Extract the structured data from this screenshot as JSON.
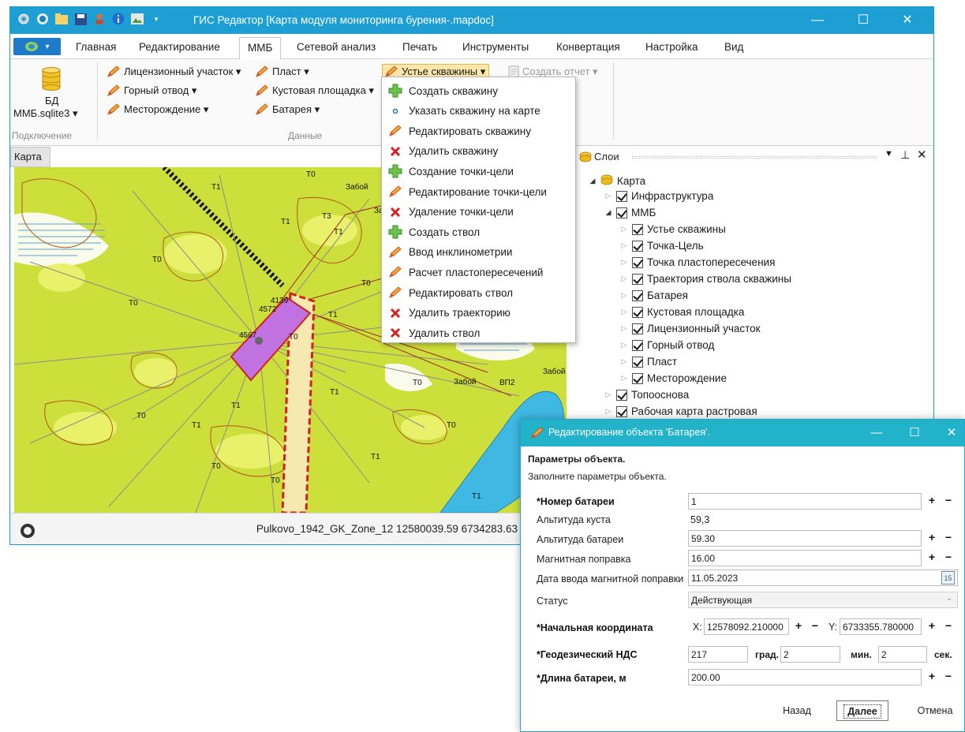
{
  "window": {
    "title": "ГИС Редактор [Карта модуля мониторинга бурения-.mapdoc]",
    "controls": [
      "—",
      "☐",
      "✕"
    ]
  },
  "menu": {
    "tabs": [
      "Главная",
      "Редактирование",
      "ММБ",
      "Сетевой анализ",
      "Печать",
      "Инструменты",
      "Конвертация",
      "Настройка",
      "Вид"
    ],
    "active_tab": "ММБ"
  },
  "ribbon": {
    "db_label_1": "БД",
    "db_label_2": "ММБ.sqlite3 ▾",
    "group_connection": "Подключение",
    "group_data": "Данные",
    "items": {
      "license": "Лицензионный участок ▾",
      "mining": "Горный отвод ▾",
      "field": "Месторождение ▾",
      "layer": "Пласт ▾",
      "pad": "Кустовая площадка ▾",
      "battery": "Батарея ▾",
      "wellhead": "Устье скважины ▾",
      "report": "Создать отчет ▾"
    }
  },
  "dropdown": {
    "items": [
      {
        "label": "Создать скважину",
        "icon": "plus-icon"
      },
      {
        "label": "Указать скважину на карте",
        "icon": "dot-icon"
      },
      {
        "label": "Редактировать скважину",
        "icon": "pencil-icon"
      },
      {
        "label": "Удалить скважину",
        "icon": "x-icon"
      },
      {
        "label": "Создание точки-цели",
        "icon": "plus-icon"
      },
      {
        "label": "Редактирование точки-цели",
        "icon": "pencil-icon"
      },
      {
        "label": "Удаление точки-цели",
        "icon": "x-icon"
      },
      {
        "label": "Создать ствол",
        "icon": "plus-icon"
      },
      {
        "label": "Ввод инклинометрии",
        "icon": "pencil-icon"
      },
      {
        "label": "Расчет пластопересечений",
        "icon": "pencil-icon"
      },
      {
        "label": "Редактировать ствол",
        "icon": "pencil-icon"
      },
      {
        "label": "Удалить траекторию",
        "icon": "x-icon"
      },
      {
        "label": "Удалить ствол",
        "icon": "x-icon"
      }
    ]
  },
  "map": {
    "tab_label": "Карта",
    "labels": [
      "T1",
      "T0",
      "T1",
      "T3",
      "T1",
      "T0",
      "T0",
      "T0",
      "T1",
      "4139",
      "4572",
      "4567",
      "T0",
      "T1",
      "T0",
      "T1",
      "T0",
      "T0",
      "T1",
      "T1",
      "T0",
      "T0",
      "T1",
      "Забой",
      "Забой",
      "Забой",
      "Забой",
      "ВП2"
    ],
    "status_coords": "Pulkovo_1942_GK_Zone_12  12580039.59   6734283.63 м"
  },
  "layers": {
    "title": "Слои",
    "tree": [
      {
        "label": "Карта",
        "level": 0,
        "root": true
      },
      {
        "label": "Инфраструктура",
        "level": 1
      },
      {
        "label": "ММБ",
        "level": 1,
        "open": true
      },
      {
        "label": "Устье скважины",
        "level": 2
      },
      {
        "label": "Точка-Цель",
        "level": 2
      },
      {
        "label": "Точка пластопересечения",
        "level": 2
      },
      {
        "label": "Траектория ствола скважины",
        "level": 2
      },
      {
        "label": "Батарея",
        "level": 2
      },
      {
        "label": "Кустовая площадка",
        "level": 2
      },
      {
        "label": "Лицензионный участок",
        "level": 2
      },
      {
        "label": "Горный отвод",
        "level": 2
      },
      {
        "label": "Пласт",
        "level": 2
      },
      {
        "label": "Месторождение",
        "level": 2
      },
      {
        "label": "Топооснова",
        "level": 1
      },
      {
        "label": "Рабочая карта растровая",
        "level": 1
      }
    ]
  },
  "dialog": {
    "title": "Редактирование объекта 'Батарея'.",
    "heading": "Параметры объекта.",
    "subheading": "Заполните параметры объекта.",
    "fields": {
      "battery_number_label": "*Номер батареи",
      "battery_number": "1",
      "pad_altitude_label": "Альтитуда куста",
      "pad_altitude": "59,3",
      "battery_altitude_label": "Альтитуда батареи",
      "battery_altitude": "59.30",
      "mag_correction_label": "Магнитная поправка",
      "mag_correction": "16.00",
      "mag_date_label": "Дата ввода магнитной поправки",
      "mag_date": "11.05.2023",
      "status_label": "Статус",
      "status": "Действующая",
      "start_coord_label": "*Начальная координата",
      "x_label": "X:",
      "x_value": "12578092.210000",
      "y_label": "Y:",
      "y_value": "6733355.780000",
      "geodesic_label": "*Геодезический НДС",
      "deg": "217",
      "deg_unit": "град.",
      "min": "2",
      "min_unit": "мин.",
      "sec": "2",
      "sec_unit": "сек.",
      "length_label": "*Длина батареи, м",
      "length": "200.00"
    },
    "calendar_day": "15",
    "buttons": {
      "back": "Назад",
      "next": "Далее",
      "cancel": "Отмена"
    }
  }
}
